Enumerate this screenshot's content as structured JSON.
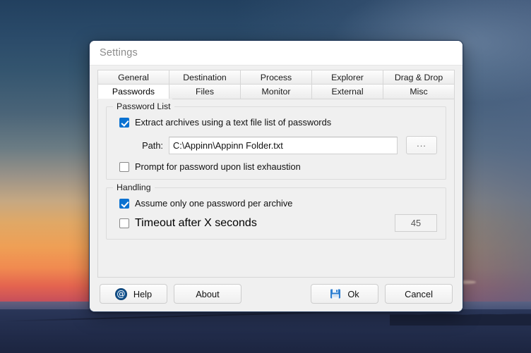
{
  "window": {
    "title": "Settings"
  },
  "tabs": {
    "row1": [
      {
        "label": "General",
        "selected": false
      },
      {
        "label": "Destination",
        "selected": false
      },
      {
        "label": "Process",
        "selected": false
      },
      {
        "label": "Explorer",
        "selected": false
      },
      {
        "label": "Drag & Drop",
        "selected": false
      }
    ],
    "row2": [
      {
        "label": "Passwords",
        "selected": true
      },
      {
        "label": "Files",
        "selected": false
      },
      {
        "label": "Monitor",
        "selected": false
      },
      {
        "label": "External",
        "selected": false
      },
      {
        "label": "Misc",
        "selected": false
      }
    ]
  },
  "password_list": {
    "group_title": "Password List",
    "extract_checkbox": {
      "label": "Extract archives using a text file list of passwords",
      "checked": true
    },
    "path": {
      "label": "Path:",
      "value": "C:\\Appinn\\Appinn Folder.txt",
      "placeholder": "",
      "browse_label": "..."
    },
    "prompt_checkbox": {
      "label": "Prompt for password upon list exhaustion",
      "checked": false
    }
  },
  "handling": {
    "group_title": "Handling",
    "assume_checkbox": {
      "label": "Assume only one password per archive",
      "checked": true
    },
    "timeout_checkbox": {
      "label": "Timeout after X seconds",
      "checked": false
    },
    "timeout_value": "45"
  },
  "buttons": {
    "help": {
      "label": "Help",
      "icon": "at-sign-icon"
    },
    "about": {
      "label": "About"
    },
    "ok": {
      "label": "Ok",
      "icon": "save-floppy-icon"
    },
    "cancel": {
      "label": "Cancel"
    }
  },
  "colors": {
    "accent_checkbox": "#0b72d1",
    "help_icon": "#14538e",
    "save_icon": "#2f7fd1",
    "window_border": "#2b4162",
    "dialog_bg": "#f0f0f0"
  }
}
